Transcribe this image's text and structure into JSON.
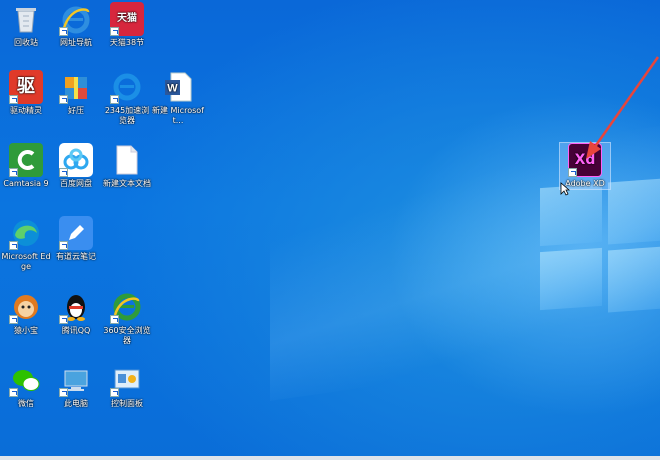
{
  "desktop": {
    "icons": [
      {
        "label": "回收站",
        "icon": "recycle-bin-icon",
        "color": "#dfe6ee"
      },
      {
        "label": "网址导航",
        "icon": "ie-browser-icon",
        "color": "#2e8ee0"
      },
      {
        "label": "天猫38节",
        "icon": "tmall-icon",
        "color": "#d7263d",
        "text": "天猫"
      },
      {
        "label": "驱动精灵",
        "icon": "driver-genius-icon",
        "color": "#e03a2a",
        "text": "驱"
      },
      {
        "label": "好压",
        "icon": "haozip-icon",
        "color": "#2f8fd8"
      },
      {
        "label": "2345加速浏览器",
        "icon": "browser-2345-icon",
        "color": "#1b8fe6"
      },
      {
        "label": "新建 Microsoft...",
        "icon": "word-document-icon",
        "color": "#2b579a",
        "text": "W"
      },
      {
        "label": "Camtasia 9",
        "icon": "camtasia-icon",
        "color": "#2f9b3a"
      },
      {
        "label": "百度网盘",
        "icon": "baidu-netdisk-icon",
        "color": "#2ea8f0"
      },
      {
        "label": "新建文本文档",
        "icon": "text-document-icon",
        "color": "#ffffff"
      },
      {
        "label": "Microsoft Edge",
        "icon": "edge-icon",
        "color": "#0c8fd8"
      },
      {
        "label": "有道云笔记",
        "icon": "youdao-note-icon",
        "color": "#3a8ef0"
      },
      {
        "label": "猿小宝",
        "icon": "monkey-app-icon",
        "color": "#e07a20"
      },
      {
        "label": "腾讯QQ",
        "icon": "qq-penguin-icon",
        "color": "#111111"
      },
      {
        "label": "360安全浏览器",
        "icon": "browser-360-icon",
        "color": "#2f9b3a"
      },
      {
        "label": "微信",
        "icon": "wechat-icon",
        "color": "#2dc100"
      },
      {
        "label": "此电脑",
        "icon": "this-pc-icon",
        "color": "#4aa3df"
      },
      {
        "label": "控制面板",
        "icon": "control-panel-icon",
        "color": "#4a90d8"
      }
    ],
    "selected_icon": {
      "label": "Adobe XD",
      "icon": "adobe-xd-icon",
      "text": "Xd",
      "color": "#470137",
      "accent": "#ff61f6"
    }
  },
  "annotation": {
    "arrow_color": "#e8453c"
  }
}
